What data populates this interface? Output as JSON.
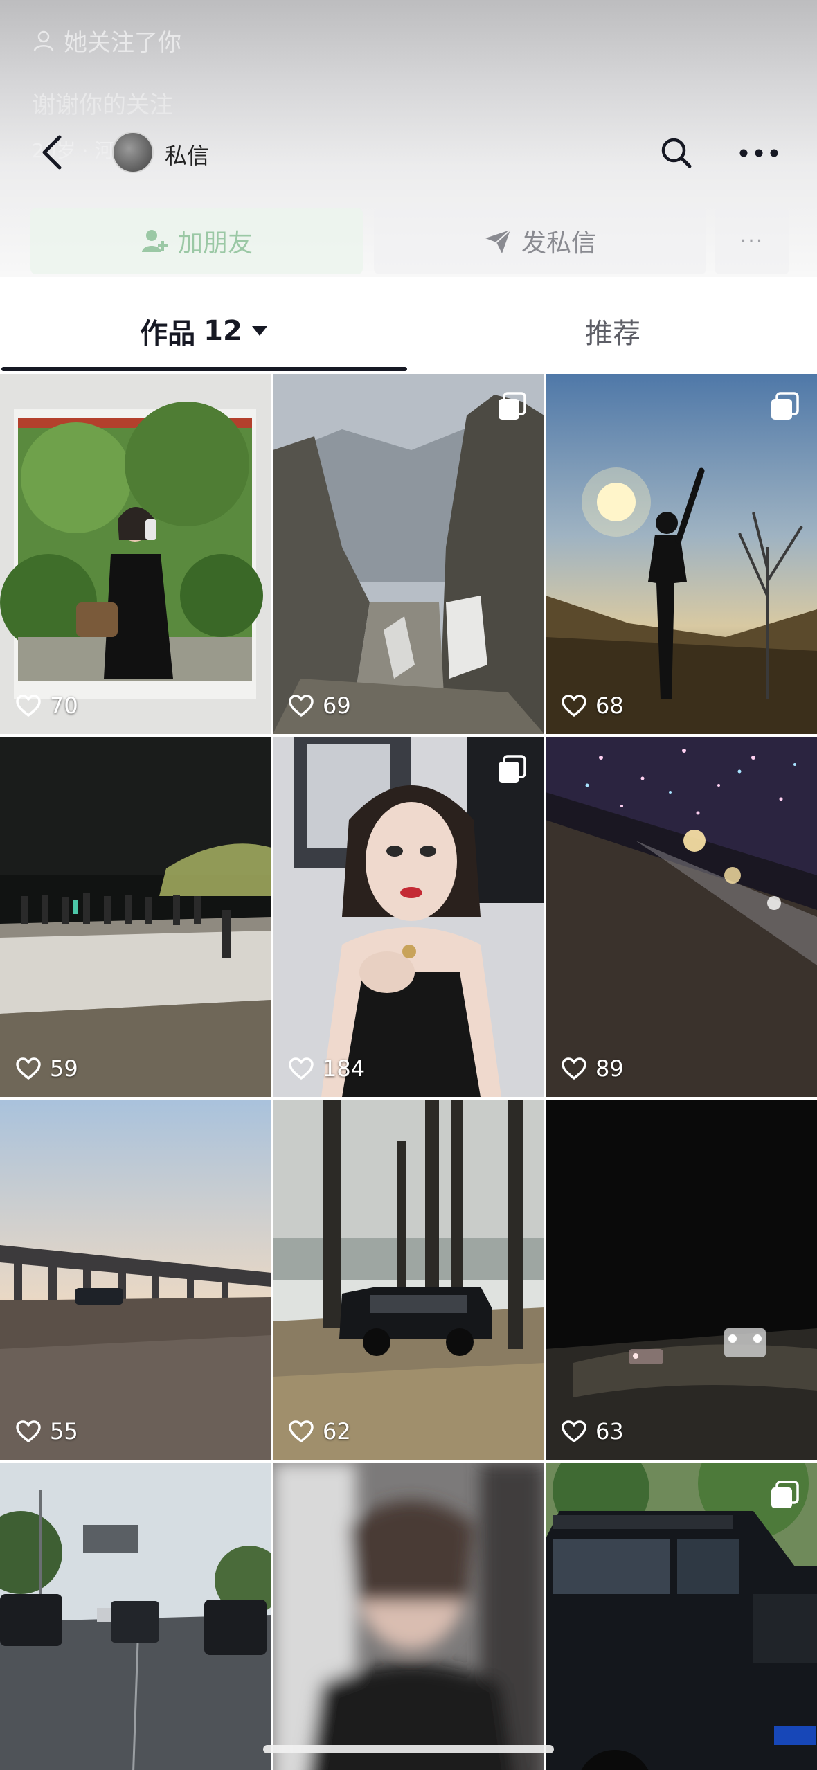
{
  "profile": {
    "follow_note": "她关注了你",
    "bio": "谢谢你的关注",
    "meta": "20岁 · 河南"
  },
  "nav": {
    "title": "私信"
  },
  "actions": {
    "add_friend": "加朋友",
    "send_message": "发私信",
    "more": "···"
  },
  "tabs": {
    "works_label": "作品",
    "works_count": "12",
    "recommend_label": "推荐"
  },
  "posts": [
    {
      "likes": "70",
      "multi": false
    },
    {
      "likes": "69",
      "multi": true
    },
    {
      "likes": "68",
      "multi": true
    },
    {
      "likes": "59",
      "multi": false
    },
    {
      "likes": "184",
      "multi": true
    },
    {
      "likes": "89",
      "multi": false
    },
    {
      "likes": "55",
      "multi": false
    },
    {
      "likes": "62",
      "multi": false
    },
    {
      "likes": "63",
      "multi": false
    },
    {
      "likes": "",
      "multi": false
    },
    {
      "likes": "",
      "multi": false
    },
    {
      "likes": "",
      "multi": true
    }
  ],
  "colors": {
    "accent_text": "#161823",
    "add_friend_green": "#9bc8a5"
  }
}
